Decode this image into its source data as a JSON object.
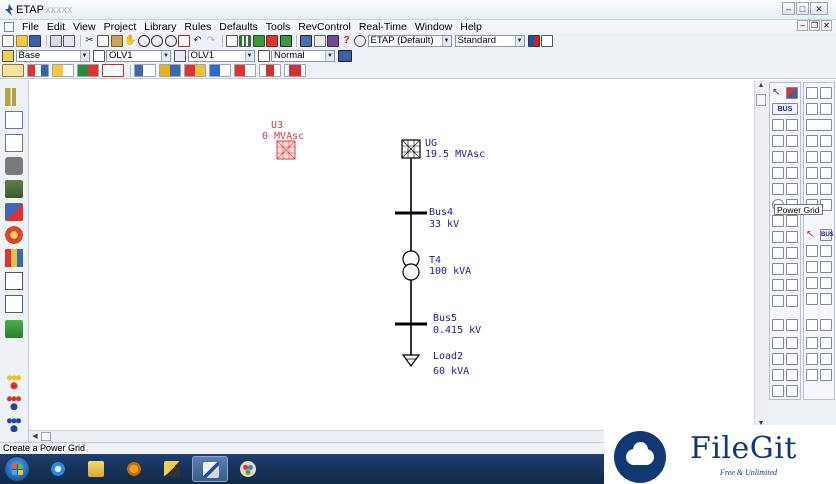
{
  "window": {
    "title": "ETAP",
    "subtitle": "xxxxx"
  },
  "menu": [
    "File",
    "Edit",
    "View",
    "Project",
    "Library",
    "Rules",
    "Defaults",
    "Tools",
    "RevControl",
    "Real-Time",
    "Window",
    "Help"
  ],
  "toolbar": {
    "config_combo": "ETAP (Default)",
    "standard_combo": "Standard",
    "mode_combo": "Base",
    "olv_combo_1": "OLV1",
    "olv_combo_2": "OLV1",
    "display_combo": "Normal"
  },
  "diagram": {
    "u3": {
      "name": "U3",
      "rating": "0 MVAsc"
    },
    "ug": {
      "name": "UG",
      "rating": "19.5 MVAsc"
    },
    "bus4": {
      "name": "Bus4",
      "rating": "33 kV"
    },
    "t4": {
      "name": "T4",
      "rating": "100 kVA"
    },
    "bus5": {
      "name": "Bus5",
      "rating": "0.415 kV"
    },
    "load2": {
      "name": "Load2",
      "rating": "60 kVA"
    },
    "colors": {
      "element": "#1a1aaa",
      "inactive": "#e03a3a",
      "line": "#000000"
    }
  },
  "palette": {
    "tooltip": "Power Grid"
  },
  "status": {
    "text": "Create a Power Grid"
  },
  "watermark": {
    "brand": "FileGit",
    "tagline": "Free & Unlimited"
  }
}
